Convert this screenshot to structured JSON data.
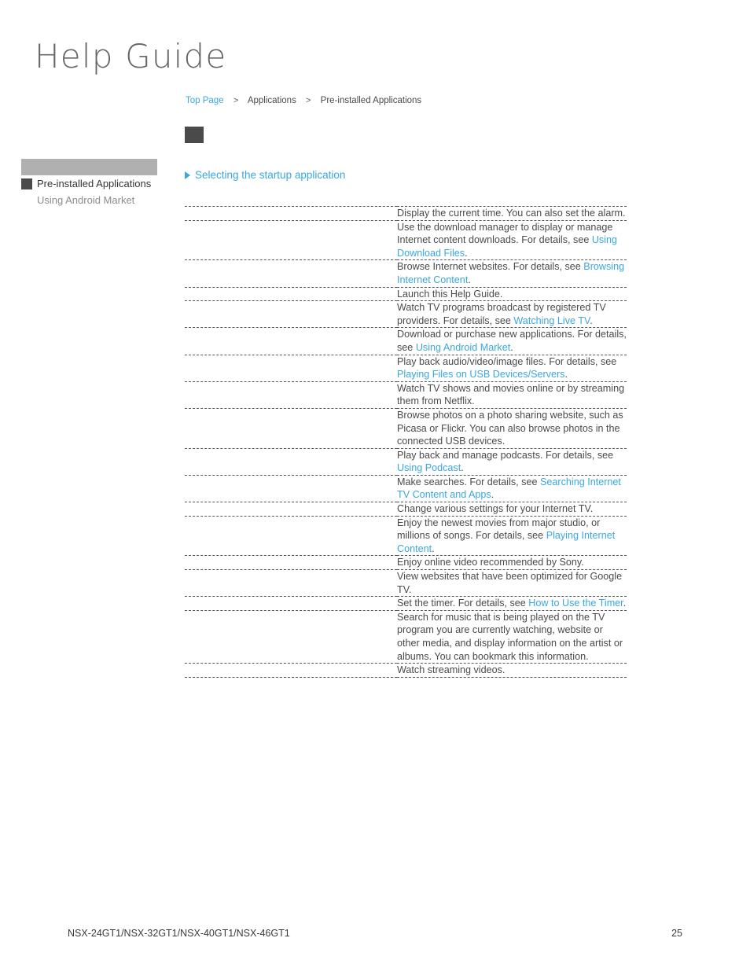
{
  "header": {
    "title": "Help Guide"
  },
  "breadcrumb": {
    "items": [
      {
        "label": "Top Page",
        "type": "link"
      },
      {
        "label": "Applications",
        "type": "text"
      },
      {
        "label": "Pre-installed Applications",
        "type": "current"
      }
    ],
    "separator": ">"
  },
  "sidebar": {
    "items": [
      {
        "label": "Pre-installed Applications",
        "state": "current"
      },
      {
        "label": "Using Android Market",
        "state": "other"
      }
    ]
  },
  "content": {
    "startup_link": "Selecting the startup application",
    "rows": [
      {
        "icon": "clock-app-icon",
        "parts": [
          {
            "t": "Display the current time. You can also set the alarm.",
            "link": false
          }
        ]
      },
      {
        "icon": "downloads-app-icon",
        "parts": [
          {
            "t": "Use the download manager to display or manage Internet content downloads. For details, see ",
            "link": false
          },
          {
            "t": "Using Download Files",
            "link": true
          },
          {
            "t": ".",
            "link": false
          }
        ]
      },
      {
        "icon": "browser-app-icon",
        "parts": [
          {
            "t": "Browse Internet websites. For details, see ",
            "link": false
          },
          {
            "t": "Browsing Internet Content",
            "link": true
          },
          {
            "t": ".",
            "link": false
          }
        ]
      },
      {
        "icon": "help-guide-app-icon",
        "parts": [
          {
            "t": "Launch this Help Guide.",
            "link": false
          }
        ]
      },
      {
        "icon": "live-tv-app-icon",
        "parts": [
          {
            "t": "Watch TV programs broadcast by registered TV providers. For details, see ",
            "link": false
          },
          {
            "t": "Watching Live TV",
            "link": true
          },
          {
            "t": ".",
            "link": false
          }
        ]
      },
      {
        "icon": "android-market-app-icon",
        "parts": [
          {
            "t": "Download or purchase new applications. For details, see ",
            "link": false
          },
          {
            "t": "Using Android Market",
            "link": true
          },
          {
            "t": ".",
            "link": false
          }
        ]
      },
      {
        "icon": "media-player-app-icon",
        "parts": [
          {
            "t": "Play back audio/video/image files. For details, see ",
            "link": false
          },
          {
            "t": "Playing Files on USB Devices/Servers",
            "link": true
          },
          {
            "t": ".",
            "link": false
          }
        ]
      },
      {
        "icon": "netflix-app-icon",
        "parts": [
          {
            "t": "Watch TV shows and movies online or by streaming them from Netflix.",
            "link": false
          }
        ]
      },
      {
        "icon": "photo-app-icon",
        "parts": [
          {
            "t": "Browse photos on a photo sharing website, such as Picasa or Flickr. You can also browse photos in the connected USB devices.",
            "link": false
          }
        ]
      },
      {
        "icon": "podcast-app-icon",
        "parts": [
          {
            "t": "Play back and manage podcasts. For details, see ",
            "link": false
          },
          {
            "t": "Using Podcast",
            "link": true
          },
          {
            "t": ".",
            "link": false
          }
        ]
      },
      {
        "icon": "search-app-icon",
        "parts": [
          {
            "t": "Make searches. For details, see ",
            "link": false
          },
          {
            "t": "Searching Internet TV Content and Apps",
            "link": true
          },
          {
            "t": ".",
            "link": false
          }
        ]
      },
      {
        "icon": "settings-app-icon",
        "parts": [
          {
            "t": "Change various settings for your Internet TV.",
            "link": false
          }
        ]
      },
      {
        "icon": "qriocity-app-icon",
        "parts": [
          {
            "t": "Enjoy the newest movies from major studio, or millions of songs. For details, see ",
            "link": false
          },
          {
            "t": "Playing Internet Content",
            "link": true
          },
          {
            "t": ".",
            "link": false
          }
        ]
      },
      {
        "icon": "sony-select-app-icon",
        "parts": [
          {
            "t": "Enjoy online video recommended by Sony.",
            "link": false
          }
        ]
      },
      {
        "icon": "spotlight-app-icon",
        "parts": [
          {
            "t": "View websites that have been optimized for Google TV.",
            "link": false
          }
        ]
      },
      {
        "icon": "timer-app-icon",
        "parts": [
          {
            "t": "Set the timer. For details, see ",
            "link": false
          },
          {
            "t": "How to Use the Timer",
            "link": true
          },
          {
            "t": ".",
            "link": false
          }
        ]
      },
      {
        "icon": "trackid-app-icon",
        "parts": [
          {
            "t": "Search for music that is being played on the TV program you are currently watching, website or other media, and display information on the artist or albums. You can bookmark this information.",
            "link": false
          }
        ]
      },
      {
        "icon": "video-app-icon",
        "parts": [
          {
            "t": "Watch streaming videos.",
            "link": false
          }
        ]
      }
    ]
  },
  "footer": {
    "models": "NSX-24GT1/NSX-32GT1/NSX-40GT1/NSX-46GT1",
    "page": "25"
  },
  "colors": {
    "link": "#3aa7e0",
    "text": "#4a4a4a",
    "sidebar_bar": "#b0b0b0",
    "marker": "#4a4a4a",
    "title": "#676767"
  }
}
